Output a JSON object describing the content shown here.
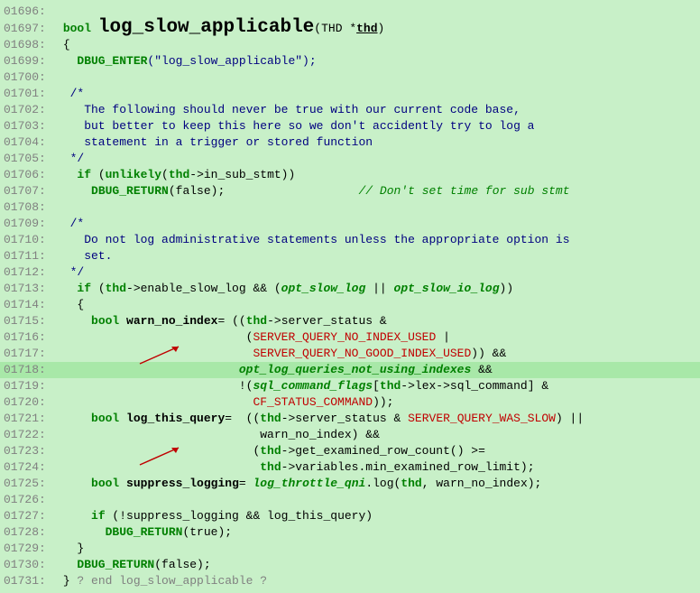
{
  "lines": {
    "l1696": "",
    "l1697_prefix": "bool",
    "l1697_func": "log_slow_applicable",
    "l1697_paren_open": "(",
    "l1697_type": "THD *",
    "l1697_param": "thd",
    "l1697_paren_close": ")",
    "l1698": "{",
    "l1699_macro": "DBUG_ENTER",
    "l1699_rest": "(\"log_slow_applicable\");",
    "l1700": "",
    "l1701": "  /*",
    "l1702": "    The following should never be true with our current code base,",
    "l1703": "    but better to keep this here so we don't accidently try to log a",
    "l1704": "    statement in a trigger or stored function",
    "l1705": "  */",
    "l1706_if": "if",
    "l1706_open": " (",
    "l1706_unlikely": "unlikely",
    "l1706_rest1": "(",
    "l1706_thd": "thd",
    "l1706_rest2": "->in_sub_stmt))",
    "l1707_macro": "DBUG_RETURN",
    "l1707_rest": "(false);",
    "l1707_comment": "// Don't set time for sub stmt",
    "l1708": "",
    "l1709": "  /*",
    "l1710": "    Do not log administrative statements unless the appropriate option is",
    "l1711": "    set.",
    "l1712": "  */",
    "l1713_if": "if",
    "l1713_open": " (",
    "l1713_thd": "thd",
    "l1713_mid": "->enable_slow_log && (",
    "l1713_f1": "opt_slow_log",
    "l1713_or": " || ",
    "l1713_f2": "opt_slow_io_log",
    "l1713_end": "))",
    "l1714": "  {",
    "l1715_bool": "bool",
    "l1715_var": "warn_no_index",
    "l1715_eq": "= ((",
    "l1715_thd": "thd",
    "l1715_rest": "->server_status &",
    "l1716_open": "(",
    "l1716_c1": "SERVER_QUERY_NO_INDEX_USED",
    "l1716_pipe": " |",
    "l1717_c2": "SERVER_QUERY_NO_GOOD_INDEX_USED",
    "l1717_close": ")) &&",
    "l1718_flag": "opt_log_queries_not_using_indexes",
    "l1718_and": " &&",
    "l1719_bang": "!(",
    "l1719_flag": "sql_command_flags",
    "l1719_open": "[",
    "l1719_thd": "thd",
    "l1719_rest": "->lex->sql_command] &",
    "l1720_c": "CF_STATUS_COMMAND",
    "l1720_close": "));",
    "l1721_bool": "bool",
    "l1721_var": "log_this_query",
    "l1721_eq": "=  ((",
    "l1721_thd": "thd",
    "l1721_mid": "->server_status & ",
    "l1721_c": "SERVER_QUERY_WAS_SLOW",
    "l1721_end": ") ||",
    "l1722_rest": "warn_no_index) &&",
    "l1723_open": "(",
    "l1723_thd": "thd",
    "l1723_rest": "->get_examined_row_count() >=",
    "l1724_thd": "thd",
    "l1724_rest": "->variables.min_examined_row_limit);",
    "l1725_bool": "bool",
    "l1725_var": "suppress_logging",
    "l1725_eq": "= ",
    "l1725_flag": "log_throttle_qni",
    "l1725_mid": ".log(",
    "l1725_thd": "thd",
    "l1725_rest": ", warn_no_index);",
    "l1726": "",
    "l1727_if": "if",
    "l1727_rest": " (!suppress_logging && log_this_query)",
    "l1728_macro": "DBUG_RETURN",
    "l1728_rest": "(true);",
    "l1729": "  }",
    "l1730_macro": "DBUG_RETURN",
    "l1730_rest": "(false);",
    "l1731_close": "} ",
    "l1731_q": "? end log_slow_applicable ?"
  },
  "linenos": {
    "n1696": "01696:",
    "n1697": "01697:",
    "n1698": "01698:",
    "n1699": "01699:",
    "n1700": "01700:",
    "n1701": "01701:",
    "n1702": "01702:",
    "n1703": "01703:",
    "n1704": "01704:",
    "n1705": "01705:",
    "n1706": "01706:",
    "n1707": "01707:",
    "n1708": "01708:",
    "n1709": "01709:",
    "n1710": "01710:",
    "n1711": "01711:",
    "n1712": "01712:",
    "n1713": "01713:",
    "n1714": "01714:",
    "n1715": "01715:",
    "n1716": "01716:",
    "n1717": "01717:",
    "n1718": "01718:",
    "n1719": "01719:",
    "n1720": "01720:",
    "n1721": "01721:",
    "n1722": "01722:",
    "n1723": "01723:",
    "n1724": "01724:",
    "n1725": "01725:",
    "n1726": "01726:",
    "n1727": "01727:",
    "n1728": "01728:",
    "n1729": "01729:",
    "n1730": "01730:",
    "n1731": "01731:"
  }
}
